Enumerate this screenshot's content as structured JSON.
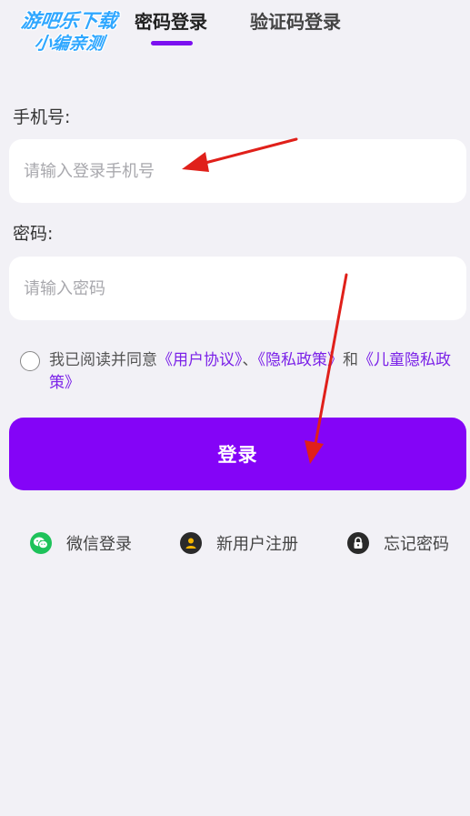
{
  "watermark": {
    "line1": "游吧乐下载",
    "line2": "小编亲测"
  },
  "tabs": [
    {
      "label": "密码登录",
      "active": true
    },
    {
      "label": "验证码登录",
      "active": false
    }
  ],
  "phone": {
    "label": "手机号:",
    "placeholder": "请输入登录手机号",
    "value": ""
  },
  "password": {
    "label": "密码:",
    "placeholder": "请输入密码",
    "value": ""
  },
  "agreement": {
    "checked": false,
    "prefix": "我已阅读并同意",
    "user_agreement": "《用户协议》",
    "sep": "、",
    "privacy_policy": "《隐私政策》",
    "and": "和",
    "children_privacy": "《儿童隐私政策》"
  },
  "login_button": "登录",
  "options": {
    "wechat": "微信登录",
    "register": "新用户注册",
    "forgot": "忘记密码"
  },
  "colors": {
    "accent": "#8404f7",
    "link": "#7b22e8",
    "background": "#f2f1f6",
    "wechat": "#1ec25a",
    "annotation": "#e0201a"
  }
}
